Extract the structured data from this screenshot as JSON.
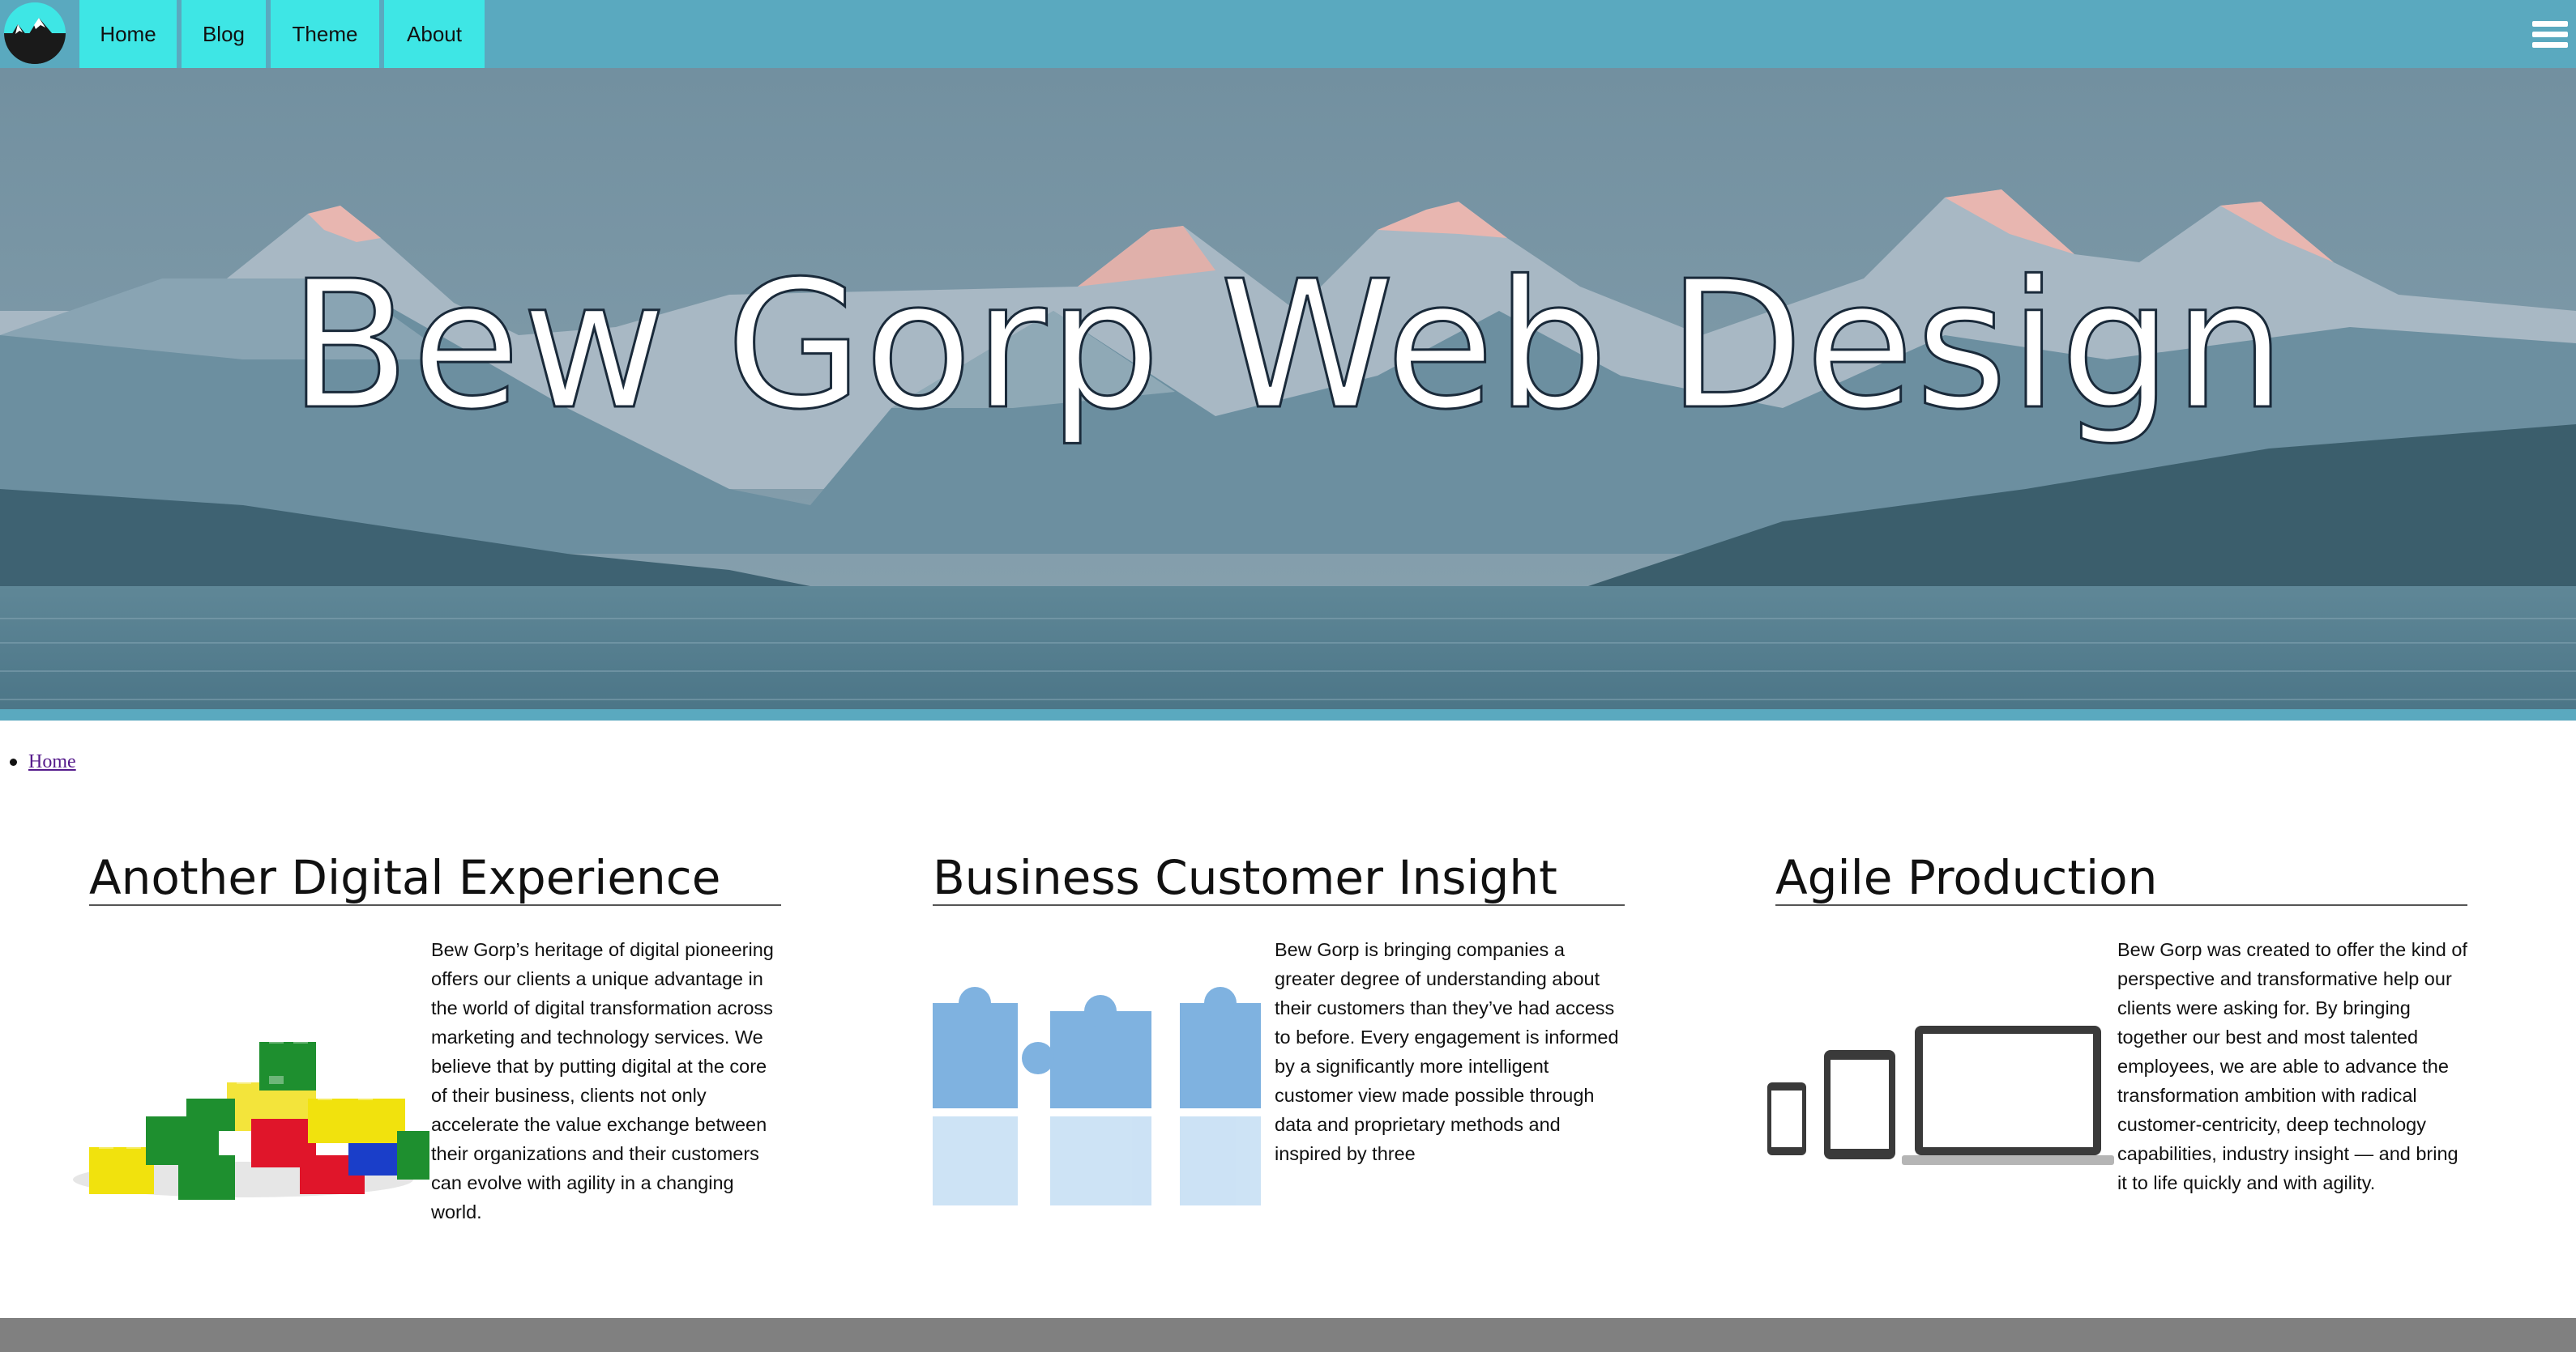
{
  "nav": {
    "logo": "mountain-logo",
    "links": [
      {
        "label": "Home"
      },
      {
        "label": "Blog"
      },
      {
        "label": "Theme"
      },
      {
        "label": "About"
      }
    ],
    "menu_icon": "hamburger-menu-icon"
  },
  "hero": {
    "title": "Bew Gorp Web Design"
  },
  "breadcrumb": {
    "items": [
      {
        "label": "Home"
      }
    ]
  },
  "columns": [
    {
      "heading": "Another Digital Experience",
      "image": "lego-bricks-image",
      "body": "Bew Gorp’s heritage of digital pioneering offers our clients a unique advantage in the world of digital transformation across marketing and technology services. We believe that by putting digital at the core of their business, clients not only accelerate the value exchange between their organizations and their customers can evolve with agility in a changing world."
    },
    {
      "heading": "Business Customer Insight",
      "image": "puzzle-pieces-image",
      "body": "Bew Gorp is bringing companies a greater degree of understanding about their customers than they’ve had access to before. Every engagement is informed by a significantly more intelligent customer view made possible through data and proprietary methods and inspired by three"
    },
    {
      "heading": "Agile Production",
      "image": "devices-image",
      "body": "Bew Gorp was created to offer the kind of perspective and transformative help our clients were asking for. By bringing together our best and most talented employees, we are able to advance the transformation ambition with radical customer-centricity, deep technology capabilities, industry insight — and bring it to life quickly and with agility."
    }
  ],
  "colors": {
    "navbar": "#5aa9bf",
    "nav_button": "#3ee6e5",
    "footer": "#808080",
    "link": "#551a8b"
  }
}
